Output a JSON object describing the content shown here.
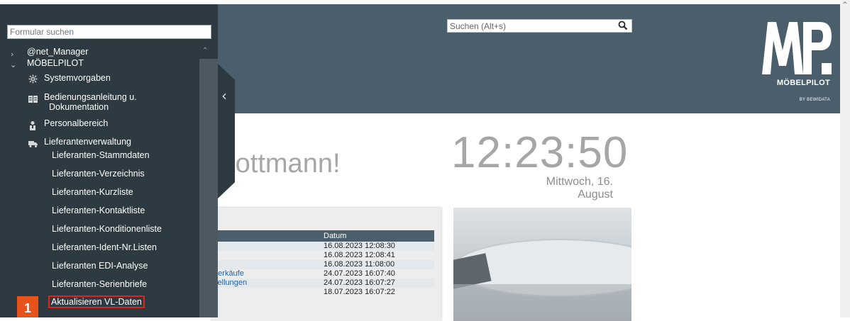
{
  "sidebar": {
    "form_search_placeholder": "Formular suchen",
    "tree": {
      "root1": "@net_Manager",
      "root2": "MÖBELPILOT",
      "sys": "Systemvorgaben",
      "doc_line1": "Bedienungsanleitung u.",
      "doc_line2": "Dokumentation",
      "personal": "Personalbereich",
      "lief": "Lieferantenverwaltung",
      "items": [
        "Lieferanten-Stammdaten",
        "Lieferanten-Verzeichnis",
        "Lieferanten-Kurzliste",
        "Lieferanten-Kontaktliste",
        "Lieferanten-Konditionenliste",
        "Lieferanten-Ident-Nr.Listen",
        "Lieferanten EDI-Analyse",
        "Lieferanten-Serienbriefe",
        "Aktualisieren VL-Daten"
      ]
    },
    "step_badge": "1"
  },
  "header": {
    "search_placeholder": "Suchen (Alt+s)",
    "logo_text": "MÖBELPILOT",
    "logo_sub": "BY BEWIDATA"
  },
  "main": {
    "greeting": "Flottmann!",
    "clock": "12:23:50",
    "date": "Mittwoch, 16. August",
    "table": {
      "header": "Datum",
      "rows": [
        {
          "label": "",
          "date": "16.08.2023 12:08:30"
        },
        {
          "label": "",
          "date": "16.08.2023 12:08:41"
        },
        {
          "label": "",
          "date": "16.08.2023 11:08:00"
        },
        {
          "label": "rverkäufe",
          "date": "24.07.2023 16:07:40"
        },
        {
          "label": "stellungen",
          "date": "24.07.2023 16:07:27"
        },
        {
          "label": "",
          "date": "18.07.2023 16:07:22"
        }
      ]
    }
  },
  "colors": {
    "header_bg": "#4a5f6b",
    "sidebar_bg": "#2d3a41",
    "highlight": "#e2231a",
    "badge": "#e8521b",
    "link": "#1f62a8"
  }
}
